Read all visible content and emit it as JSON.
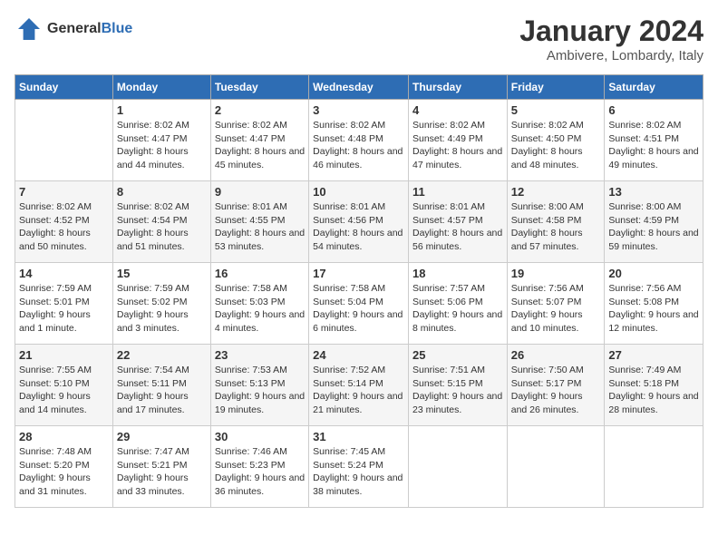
{
  "header": {
    "logo_text_general": "General",
    "logo_text_blue": "Blue",
    "month_title": "January 2024",
    "location": "Ambivere, Lombardy, Italy"
  },
  "weekdays": [
    "Sunday",
    "Monday",
    "Tuesday",
    "Wednesday",
    "Thursday",
    "Friday",
    "Saturday"
  ],
  "weeks": [
    [
      {
        "date": "",
        "sunrise": "",
        "sunset": "",
        "daylight": ""
      },
      {
        "date": "1",
        "sunrise": "Sunrise: 8:02 AM",
        "sunset": "Sunset: 4:47 PM",
        "daylight": "Daylight: 8 hours and 44 minutes."
      },
      {
        "date": "2",
        "sunrise": "Sunrise: 8:02 AM",
        "sunset": "Sunset: 4:47 PM",
        "daylight": "Daylight: 8 hours and 45 minutes."
      },
      {
        "date": "3",
        "sunrise": "Sunrise: 8:02 AM",
        "sunset": "Sunset: 4:48 PM",
        "daylight": "Daylight: 8 hours and 46 minutes."
      },
      {
        "date": "4",
        "sunrise": "Sunrise: 8:02 AM",
        "sunset": "Sunset: 4:49 PM",
        "daylight": "Daylight: 8 hours and 47 minutes."
      },
      {
        "date": "5",
        "sunrise": "Sunrise: 8:02 AM",
        "sunset": "Sunset: 4:50 PM",
        "daylight": "Daylight: 8 hours and 48 minutes."
      },
      {
        "date": "6",
        "sunrise": "Sunrise: 8:02 AM",
        "sunset": "Sunset: 4:51 PM",
        "daylight": "Daylight: 8 hours and 49 minutes."
      }
    ],
    [
      {
        "date": "7",
        "sunrise": "Sunrise: 8:02 AM",
        "sunset": "Sunset: 4:52 PM",
        "daylight": "Daylight: 8 hours and 50 minutes."
      },
      {
        "date": "8",
        "sunrise": "Sunrise: 8:02 AM",
        "sunset": "Sunset: 4:54 PM",
        "daylight": "Daylight: 8 hours and 51 minutes."
      },
      {
        "date": "9",
        "sunrise": "Sunrise: 8:01 AM",
        "sunset": "Sunset: 4:55 PM",
        "daylight": "Daylight: 8 hours and 53 minutes."
      },
      {
        "date": "10",
        "sunrise": "Sunrise: 8:01 AM",
        "sunset": "Sunset: 4:56 PM",
        "daylight": "Daylight: 8 hours and 54 minutes."
      },
      {
        "date": "11",
        "sunrise": "Sunrise: 8:01 AM",
        "sunset": "Sunset: 4:57 PM",
        "daylight": "Daylight: 8 hours and 56 minutes."
      },
      {
        "date": "12",
        "sunrise": "Sunrise: 8:00 AM",
        "sunset": "Sunset: 4:58 PM",
        "daylight": "Daylight: 8 hours and 57 minutes."
      },
      {
        "date": "13",
        "sunrise": "Sunrise: 8:00 AM",
        "sunset": "Sunset: 4:59 PM",
        "daylight": "Daylight: 8 hours and 59 minutes."
      }
    ],
    [
      {
        "date": "14",
        "sunrise": "Sunrise: 7:59 AM",
        "sunset": "Sunset: 5:01 PM",
        "daylight": "Daylight: 9 hours and 1 minute."
      },
      {
        "date": "15",
        "sunrise": "Sunrise: 7:59 AM",
        "sunset": "Sunset: 5:02 PM",
        "daylight": "Daylight: 9 hours and 3 minutes."
      },
      {
        "date": "16",
        "sunrise": "Sunrise: 7:58 AM",
        "sunset": "Sunset: 5:03 PM",
        "daylight": "Daylight: 9 hours and 4 minutes."
      },
      {
        "date": "17",
        "sunrise": "Sunrise: 7:58 AM",
        "sunset": "Sunset: 5:04 PM",
        "daylight": "Daylight: 9 hours and 6 minutes."
      },
      {
        "date": "18",
        "sunrise": "Sunrise: 7:57 AM",
        "sunset": "Sunset: 5:06 PM",
        "daylight": "Daylight: 9 hours and 8 minutes."
      },
      {
        "date": "19",
        "sunrise": "Sunrise: 7:56 AM",
        "sunset": "Sunset: 5:07 PM",
        "daylight": "Daylight: 9 hours and 10 minutes."
      },
      {
        "date": "20",
        "sunrise": "Sunrise: 7:56 AM",
        "sunset": "Sunset: 5:08 PM",
        "daylight": "Daylight: 9 hours and 12 minutes."
      }
    ],
    [
      {
        "date": "21",
        "sunrise": "Sunrise: 7:55 AM",
        "sunset": "Sunset: 5:10 PM",
        "daylight": "Daylight: 9 hours and 14 minutes."
      },
      {
        "date": "22",
        "sunrise": "Sunrise: 7:54 AM",
        "sunset": "Sunset: 5:11 PM",
        "daylight": "Daylight: 9 hours and 17 minutes."
      },
      {
        "date": "23",
        "sunrise": "Sunrise: 7:53 AM",
        "sunset": "Sunset: 5:13 PM",
        "daylight": "Daylight: 9 hours and 19 minutes."
      },
      {
        "date": "24",
        "sunrise": "Sunrise: 7:52 AM",
        "sunset": "Sunset: 5:14 PM",
        "daylight": "Daylight: 9 hours and 21 minutes."
      },
      {
        "date": "25",
        "sunrise": "Sunrise: 7:51 AM",
        "sunset": "Sunset: 5:15 PM",
        "daylight": "Daylight: 9 hours and 23 minutes."
      },
      {
        "date": "26",
        "sunrise": "Sunrise: 7:50 AM",
        "sunset": "Sunset: 5:17 PM",
        "daylight": "Daylight: 9 hours and 26 minutes."
      },
      {
        "date": "27",
        "sunrise": "Sunrise: 7:49 AM",
        "sunset": "Sunset: 5:18 PM",
        "daylight": "Daylight: 9 hours and 28 minutes."
      }
    ],
    [
      {
        "date": "28",
        "sunrise": "Sunrise: 7:48 AM",
        "sunset": "Sunset: 5:20 PM",
        "daylight": "Daylight: 9 hours and 31 minutes."
      },
      {
        "date": "29",
        "sunrise": "Sunrise: 7:47 AM",
        "sunset": "Sunset: 5:21 PM",
        "daylight": "Daylight: 9 hours and 33 minutes."
      },
      {
        "date": "30",
        "sunrise": "Sunrise: 7:46 AM",
        "sunset": "Sunset: 5:23 PM",
        "daylight": "Daylight: 9 hours and 36 minutes."
      },
      {
        "date": "31",
        "sunrise": "Sunrise: 7:45 AM",
        "sunset": "Sunset: 5:24 PM",
        "daylight": "Daylight: 9 hours and 38 minutes."
      },
      {
        "date": "",
        "sunrise": "",
        "sunset": "",
        "daylight": ""
      },
      {
        "date": "",
        "sunrise": "",
        "sunset": "",
        "daylight": ""
      },
      {
        "date": "",
        "sunrise": "",
        "sunset": "",
        "daylight": ""
      }
    ]
  ]
}
